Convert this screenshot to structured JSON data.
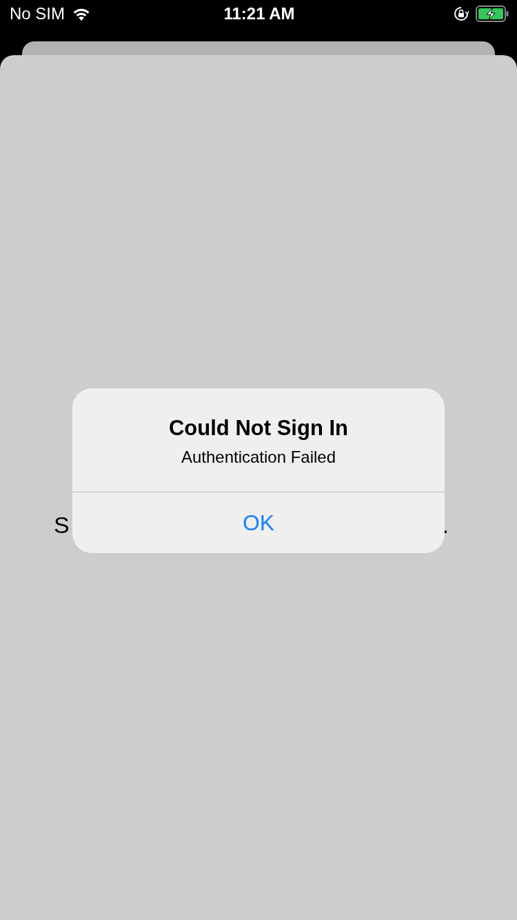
{
  "status_bar": {
    "carrier": "No SIM",
    "time": "11:21 AM"
  },
  "background_text": {
    "start": "S",
    "end": "."
  },
  "alert": {
    "title": "Could Not Sign In",
    "message": "Authentication Failed",
    "buttons": [
      {
        "label": "OK",
        "kind": "default"
      }
    ]
  }
}
